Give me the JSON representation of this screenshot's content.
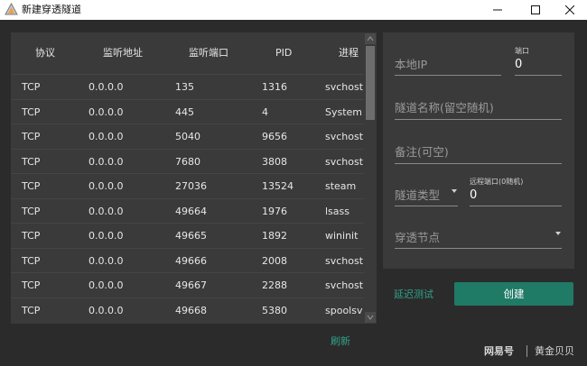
{
  "window": {
    "title": "新建穿透隧道"
  },
  "table": {
    "headers": [
      "协议",
      "监听地址",
      "监听端口",
      "PID",
      "进程"
    ],
    "rows": [
      [
        "TCP",
        "0.0.0.0",
        "135",
        "1316",
        "svchost"
      ],
      [
        "TCP",
        "0.0.0.0",
        "445",
        "4",
        "System"
      ],
      [
        "TCP",
        "0.0.0.0",
        "5040",
        "9656",
        "svchost"
      ],
      [
        "TCP",
        "0.0.0.0",
        "7680",
        "3808",
        "svchost"
      ],
      [
        "TCP",
        "0.0.0.0",
        "27036",
        "13524",
        "steam"
      ],
      [
        "TCP",
        "0.0.0.0",
        "49664",
        "1976",
        "lsass"
      ],
      [
        "TCP",
        "0.0.0.0",
        "49665",
        "1892",
        "wininit"
      ],
      [
        "TCP",
        "0.0.0.0",
        "49666",
        "2008",
        "svchost"
      ],
      [
        "TCP",
        "0.0.0.0",
        "49667",
        "2288",
        "svchost"
      ],
      [
        "TCP",
        "0.0.0.0",
        "49668",
        "5380",
        "spoolsv"
      ]
    ]
  },
  "refresh_label": "刷新",
  "form": {
    "local_ip_placeholder": "本地IP",
    "port_label": "端口",
    "port_value": "0",
    "tunnel_name_placeholder": "隧道名称(留空随机)",
    "remark_placeholder": "备注(可空)",
    "tunnel_type_placeholder": "隧道类型",
    "remote_port_label": "远程端口(0随机)",
    "remote_port_value": "0",
    "node_placeholder": "穿透节点"
  },
  "actions": {
    "latency_test_label": "延迟测试",
    "create_label": "创建"
  },
  "watermark": {
    "left": "网易号",
    "right": "黄金贝贝"
  },
  "colors": {
    "background": "#2b2b2b",
    "panel": "#3a3a3a",
    "accent_text": "#2fa389",
    "primary_button": "#1f7a66"
  }
}
